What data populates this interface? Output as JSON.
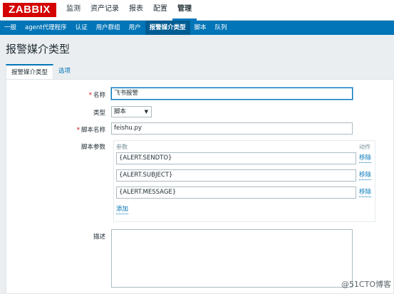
{
  "logo": "ZABBIX",
  "top_menu": [
    {
      "label": "监测"
    },
    {
      "label": "资产记录"
    },
    {
      "label": "报表"
    },
    {
      "label": "配置"
    },
    {
      "label": "管理"
    }
  ],
  "sub_menu": [
    {
      "label": "一般"
    },
    {
      "label": "agent代理程序"
    },
    {
      "label": "认证"
    },
    {
      "label": "用户群组"
    },
    {
      "label": "用户"
    },
    {
      "label": "报警媒介类型"
    },
    {
      "label": "脚本"
    },
    {
      "label": "队列"
    }
  ],
  "page_title": "报警媒介类型",
  "tabs": [
    {
      "label": "报警媒介类型"
    },
    {
      "label": "选项"
    }
  ],
  "form": {
    "name_label": "名称",
    "name_value": "飞书报警",
    "type_label": "类型",
    "type_value": "脚本",
    "script_label": "脚本名称",
    "script_value": "feishu.py",
    "params_label": "脚本参数",
    "params_col_param": "参数",
    "params_col_action": "动作",
    "params": [
      {
        "value": "{ALERT.SENDTO}",
        "action": "移除"
      },
      {
        "value": "{ALERT.SUBJECT}",
        "action": "移除"
      },
      {
        "value": "{ALERT.MESSAGE}",
        "action": "移除"
      }
    ],
    "add_label": "添加",
    "desc_label": "描述",
    "required_mark": "*"
  },
  "watermark": "@51CTO博客",
  "colors": {
    "brand": "#d40000",
    "accent": "#0275b8"
  }
}
